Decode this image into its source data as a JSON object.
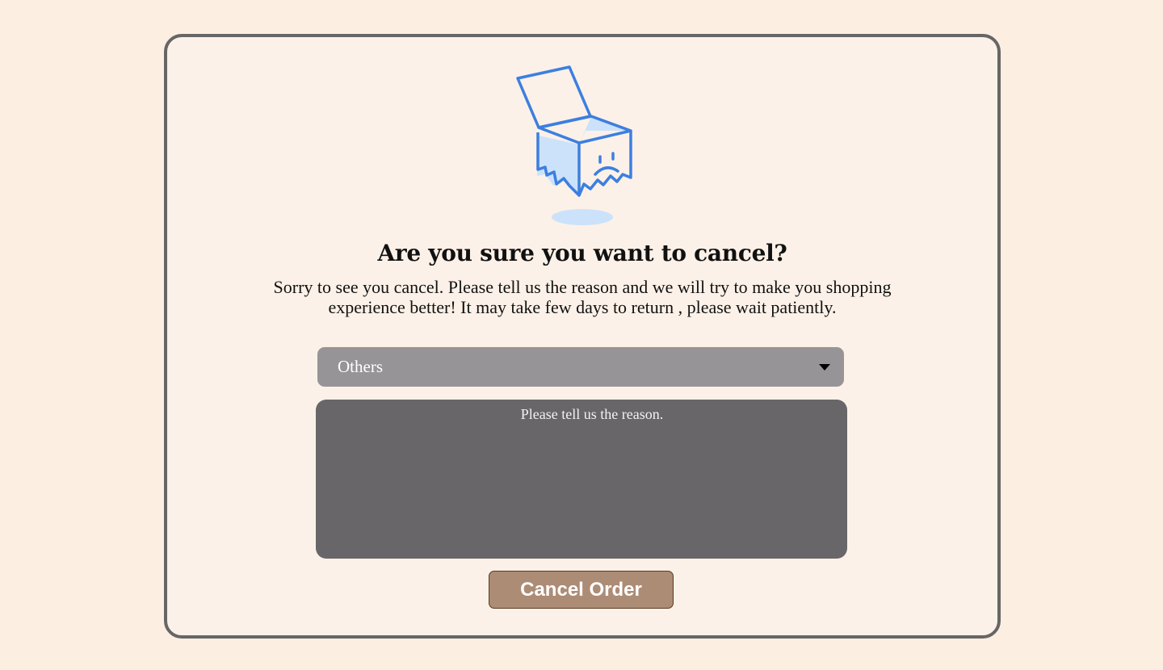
{
  "dialog": {
    "title": "Are you sure you want to cancel?",
    "message": "Sorry to see you cancel. Please tell us the reason and we will try to make you shopping experience better! It may take few days to return , please wait patiently.",
    "illustration_icon": "sad-open-box-icon"
  },
  "reason_select": {
    "selected": "Others",
    "icon": "caret-down-icon"
  },
  "reason_text": {
    "placeholder": "Please tell us the reason."
  },
  "cancel_button": {
    "label": "Cancel Order"
  },
  "colors": {
    "page_background": "#fdeee2",
    "card_background": "#fcf1e8",
    "card_border": "#666666",
    "illustration_line": "#3c7fe0",
    "illustration_fill": "#cce2fb",
    "select_background": "#969497",
    "textarea_background": "#686669",
    "button_background": "#ad8c75",
    "button_border": "#5a3a22"
  }
}
